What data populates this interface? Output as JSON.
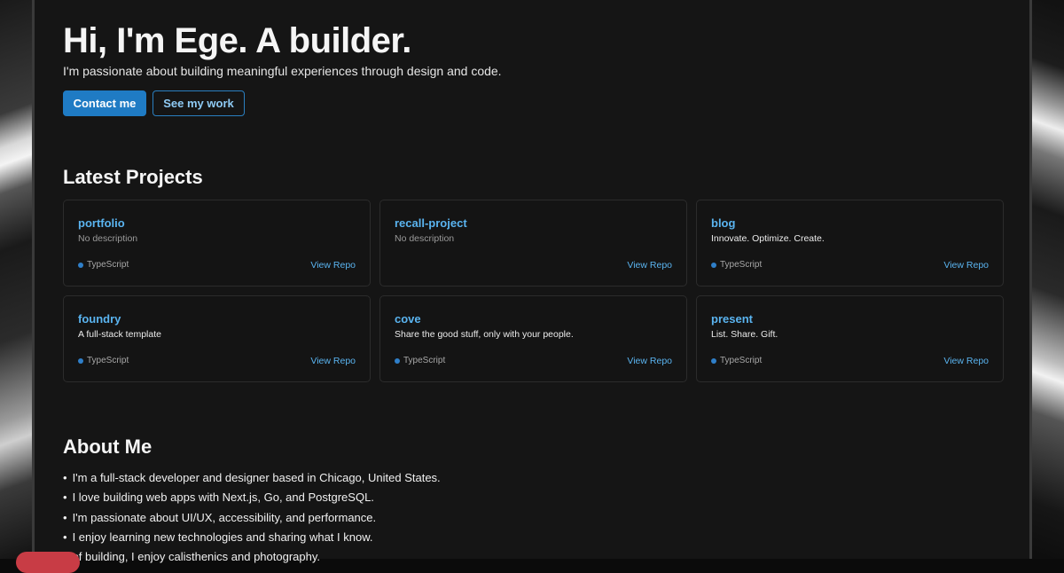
{
  "hero": {
    "title": "Hi, I'm Ege. A builder.",
    "subtitle": "I'm passionate about building meaningful experiences through design and code.",
    "contact_label": "Contact me",
    "work_label": "See my work"
  },
  "projects": {
    "heading": "Latest Projects",
    "items": [
      {
        "name": "portfolio",
        "description": "No description",
        "language": "TypeScript",
        "link_label": "View Repo"
      },
      {
        "name": "recall-project",
        "description": "No description",
        "language": "",
        "link_label": "View Repo"
      },
      {
        "name": "blog",
        "description": "Innovate. Optimize. Create.",
        "language": "TypeScript",
        "link_label": "View Repo"
      },
      {
        "name": "foundry",
        "description": "A full-stack template",
        "language": "TypeScript",
        "link_label": "View Repo"
      },
      {
        "name": "cove",
        "description": "Share the good stuff, only with your people.",
        "language": "TypeScript",
        "link_label": "View Repo"
      },
      {
        "name": "present",
        "description": "List. Share. Gift.",
        "language": "TypeScript",
        "link_label": "View Repo"
      }
    ]
  },
  "about": {
    "heading": "About Me",
    "items": [
      "I'm a full-stack developer and designer based in Chicago, United States.",
      "I love building web apps with Next.js, Go, and PostgreSQL.",
      "I'm passionate about UI/UX, accessibility, and performance.",
      "I enjoy learning new technologies and sharing what I know.",
      "of building, I enjoy calisthenics and photography."
    ]
  },
  "colors": {
    "accent": "#1f7bc4",
    "link": "#5ab4f0",
    "language_dot": "#2f7fc9",
    "background": "#151515",
    "card_border": "#2c2c2c",
    "badge": "#c83c45"
  }
}
